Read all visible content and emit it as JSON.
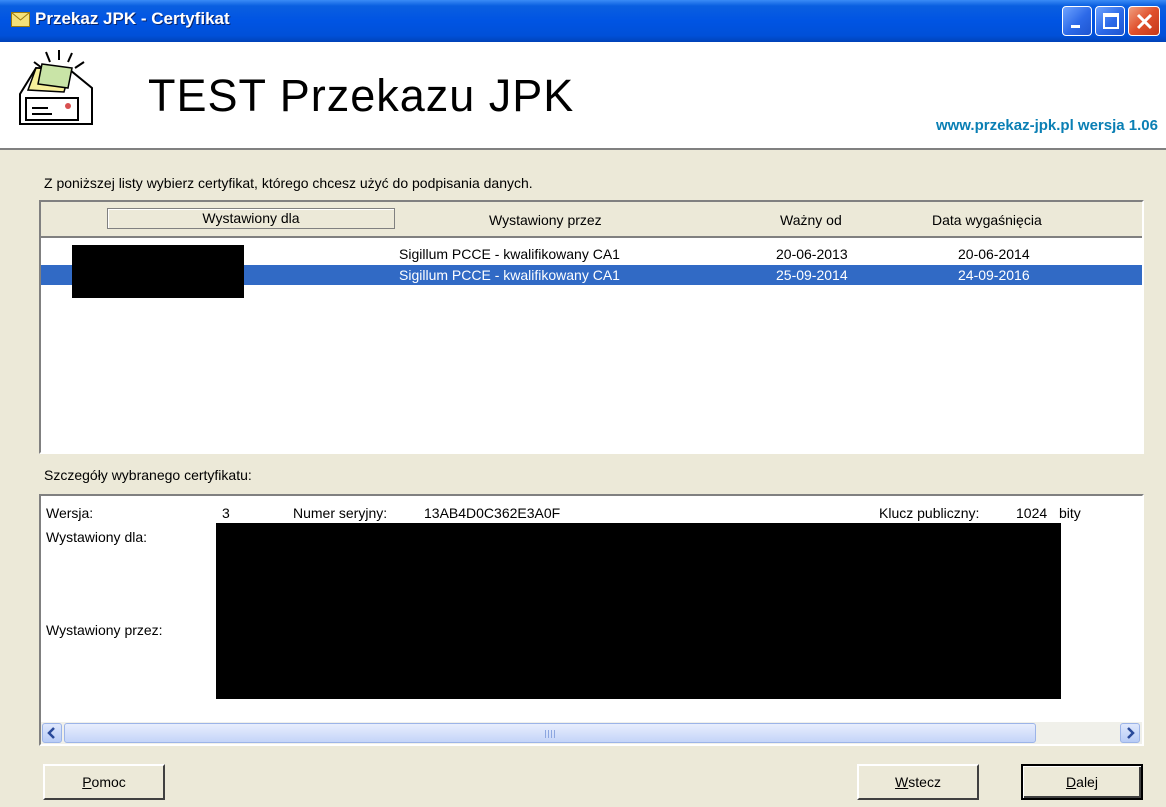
{
  "window": {
    "title": "Przekaz JPK - Certyfikat",
    "title_icon": "envelope-icon"
  },
  "header": {
    "title": "TEST Przekazu JPK",
    "version": "www.przekaz-jpk.pl wersja 1.06",
    "logo_icon": "mailbox-logo-icon"
  },
  "instruction": "Z poniższej listy wybierz certyfikat, którego chcesz użyć do podpisania danych.",
  "list": {
    "columns": [
      "Wystawiony dla",
      "Wystawiony przez",
      "Ważny od",
      "Data wygaśnięcia"
    ],
    "rows": [
      {
        "issued_to": "",
        "issued_by": "Sigillum PCCE - kwalifikowany CA1",
        "valid_from": "20-06-2013",
        "expires": "20-06-2014",
        "selected": false
      },
      {
        "issued_to": "",
        "issued_by": "Sigillum PCCE - kwalifikowany CA1",
        "valid_from": "25-09-2014",
        "expires": "24-09-2016",
        "selected": true
      }
    ]
  },
  "details": {
    "label": "Szczegóły wybranego certyfikatu:",
    "version_label": "Wersja:",
    "version_value": "3",
    "serial_label": "Numer seryjny:",
    "serial_value": "13AB4D0C362E3A0F",
    "key_label": "Klucz publiczny:",
    "key_value": "1024",
    "key_unit": "bity",
    "issued_to_label": "Wystawiony dla:",
    "issued_by_label": "Wystawiony przez:"
  },
  "buttons": {
    "help": "Pomoc",
    "back": "Wstecz",
    "next": "Dalej"
  },
  "colors": {
    "titlebar": "#0054e3",
    "selection": "#316ac5",
    "version_text": "#0a7fb4"
  }
}
